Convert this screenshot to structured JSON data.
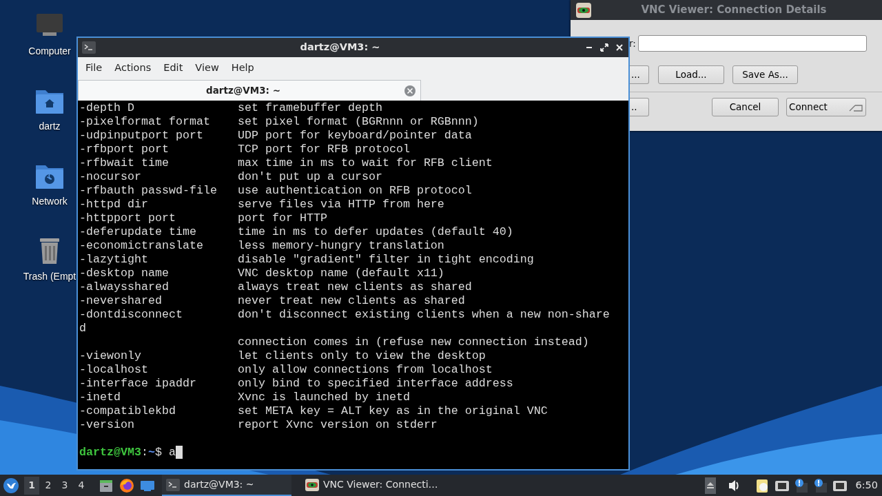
{
  "desktop_icons": [
    {
      "label": "Computer",
      "kind": "computer"
    },
    {
      "label": "dartz",
      "kind": "home"
    },
    {
      "label": "Network",
      "kind": "network"
    },
    {
      "label": "Trash (Empt",
      "kind": "trash"
    }
  ],
  "vnc_dialog": {
    "title": "VNC Viewer: Connection Details",
    "field_label": "r:",
    "buttons_row1": [
      "...",
      "Load...",
      "Save As..."
    ],
    "buttons_row2": [
      "..",
      "Cancel",
      "Connect"
    ]
  },
  "terminal": {
    "title": "dartz@VM3: ~",
    "menu": [
      "File",
      "Actions",
      "Edit",
      "View",
      "Help"
    ],
    "tabs": [
      {
        "label": "dartz@VM3: ~",
        "selected": true
      }
    ],
    "lines": [
      {
        "option": "-depth D",
        "description": "set framebuffer depth"
      },
      {
        "option": "-pixelformat format",
        "description": "set pixel format (BGRnnn or RGBnnn)"
      },
      {
        "option": "-udpinputport port",
        "description": "UDP port for keyboard/pointer data"
      },
      {
        "option": "-rfbport port",
        "description": "TCP port for RFB protocol"
      },
      {
        "option": "-rfbwait time",
        "description": "max time in ms to wait for RFB client"
      },
      {
        "option": "-nocursor",
        "description": "don't put up a cursor"
      },
      {
        "option": "-rfbauth passwd-file",
        "description": "use authentication on RFB protocol"
      },
      {
        "option": "-httpd dir",
        "description": "serve files via HTTP from here"
      },
      {
        "option": "-httpport port",
        "description": "port for HTTP"
      },
      {
        "option": "-deferupdate time",
        "description": "time in ms to defer updates (default 40)"
      },
      {
        "option": "-economictranslate",
        "description": "less memory-hungry translation"
      },
      {
        "option": "-lazytight",
        "description": "disable \"gradient\" filter in tight encoding"
      },
      {
        "option": "-desktop name",
        "description": "VNC desktop name (default x11)"
      },
      {
        "option": "-alwaysshared",
        "description": "always treat new clients as shared"
      },
      {
        "option": "-nevershared",
        "description": "never treat new clients as shared"
      },
      {
        "option": "-dontdisconnect",
        "description": "don't disconnect existing clients when a new non-share"
      },
      {
        "option": "d"
      },
      {
        "description": "connection comes in (refuse new connection instead)"
      },
      {
        "option": "-viewonly",
        "description": "let clients only to view the desktop"
      },
      {
        "option": "-localhost",
        "description": "only allow connections from localhost"
      },
      {
        "option": "-interface ipaddr",
        "description": "only bind to specified interface address"
      },
      {
        "option": "-inetd",
        "description": "Xvnc is launched by inetd"
      },
      {
        "option": "-compatiblekbd",
        "description": "set META key = ALT key as in the original VNC"
      },
      {
        "option": "-version",
        "description": "report Xvnc version on stderr"
      }
    ],
    "prompt": {
      "user_host": "dartz@VM3",
      "separator": ":",
      "path": "~",
      "symbol": "$",
      "input": "a"
    }
  },
  "taskbar": {
    "workspaces": [
      {
        "label": "1",
        "selected": true
      },
      {
        "label": "2",
        "selected": false
      },
      {
        "label": "3",
        "selected": false
      },
      {
        "label": "4",
        "selected": false
      }
    ],
    "launchers": [
      {
        "kind": "files"
      },
      {
        "kind": "firefox"
      },
      {
        "kind": "desktop"
      }
    ],
    "tasks": [
      {
        "label": "dartz@VM3: ~",
        "kind": "terminal",
        "selected": true
      },
      {
        "label": "VNC Viewer: Connecti…",
        "kind": "vnc",
        "selected": false
      }
    ],
    "tray": [
      {
        "kind": "eject"
      },
      {
        "kind": "volume"
      },
      {
        "kind": "clipboard"
      },
      {
        "kind": "network"
      },
      {
        "kind": "alert"
      },
      {
        "kind": "alert"
      },
      {
        "kind": "network"
      }
    ],
    "clock": "6:50"
  }
}
